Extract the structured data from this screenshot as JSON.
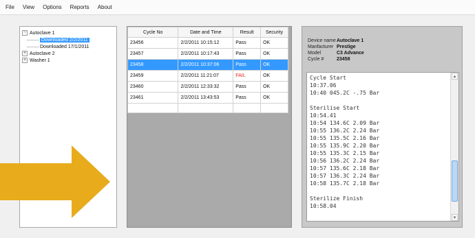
{
  "menu": [
    "File",
    "View",
    "Options",
    "Reports",
    "About"
  ],
  "tree": [
    {
      "label": "Autoclave 1",
      "expander": "−",
      "level": 0
    },
    {
      "label": "Downloaded 2/2/2011",
      "level": 1,
      "selected": true
    },
    {
      "label": "Downloaded 17/1/2011",
      "level": 1
    },
    {
      "label": "Autoclave 2",
      "expander": "+",
      "level": 0
    },
    {
      "label": "Washer 1",
      "expander": "+",
      "level": 0
    }
  ],
  "grid": {
    "headers": [
      "Cycle No",
      "Date and Time",
      "Result",
      "Security"
    ],
    "rows": [
      {
        "cycle": "23456",
        "datetime": "2/2/2011 10:15:12",
        "result": "Pass",
        "security": "OK"
      },
      {
        "cycle": "23457",
        "datetime": "2/2/2011 10:17:43",
        "result": "Pass",
        "security": "OK"
      },
      {
        "cycle": "23458",
        "datetime": "2/2/2011 10:37:06",
        "result": "Pass",
        "security": "OK",
        "selected": true
      },
      {
        "cycle": "23459",
        "datetime": "2/2/2011 11:21:07",
        "result": "FAIL",
        "security": "OK",
        "fail": true
      },
      {
        "cycle": "23460",
        "datetime": "2/2/2011 12:33:32",
        "result": "Pass",
        "security": "OK"
      },
      {
        "cycle": "23461",
        "datetime": "2/2/2011 13:43:53",
        "result": "Pass",
        "security": "OK"
      }
    ]
  },
  "details": [
    {
      "key": "Device name",
      "value": "Autoclave 1"
    },
    {
      "key": "Manfacturer",
      "value": "Prestige"
    },
    {
      "key": "Model",
      "value": "C3 Advance"
    },
    {
      "key": "Cycle #",
      "value": "23458"
    }
  ],
  "log": [
    "Cycle Start",
    "10:37.06",
    "10:40 045.2C -.75 Bar",
    "",
    "Sterilise Start",
    "10:54.41",
    "10:54 134.6C 2.09 Bar",
    "10:55 136.2C 2.24 Bar",
    "10:55 135.5C 2.16 Bar",
    "10:55 135.9C 2.20 Bar",
    "10:55 135.3C 2.15 Bar",
    "10:56 136.2C 2.24 Bar",
    "10:57 135.6C 2.18 Bar",
    "10:57 136.3C 2.24 Bar",
    "10:58 135.7C 2.18 Bar",
    "",
    "Sterilize Finish",
    "10:58.04"
  ],
  "colors": {
    "selection": "#3399ff",
    "fail": "#e0261b",
    "arrow": "#e8ab1c"
  }
}
